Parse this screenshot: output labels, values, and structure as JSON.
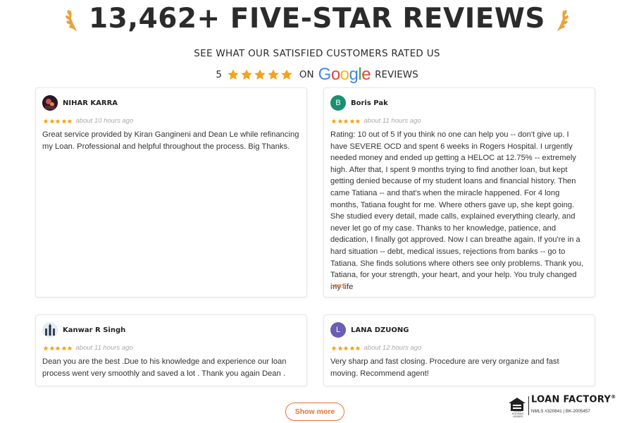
{
  "header": {
    "title": "13,462+ FIVE-STAR REVIEWS",
    "subtitle": "SEE WHAT OUR SATISFIED CUSTOMERS RATED US",
    "rating_value": "5",
    "rating_stars": 5,
    "on_label": "ON",
    "google_logo_text": "Google",
    "reviews_label": "REVIEWS"
  },
  "reviews": [
    {
      "name": "NIHAR KARRA",
      "avatar": "photo",
      "stars": 5,
      "time": "about 10 hours ago",
      "text": "Great service provided by Kiran Gangineni and Dean Le while refinancing my Loan. Professional and helpful throughout the process. Big Thanks."
    },
    {
      "name": "Boris Pak",
      "avatar": "B",
      "stars": 5,
      "time": "about 11 hours ago",
      "text": "Rating: 10 out of 5 If you think no one can help you -- don't give up. I have SEVERE OCD and spent 6 weeks in Rogers Hospital. I urgently needed money and ended up getting a HELOC at 12.75% -- extremely high. After that, I spent 9 months trying to find another loan, but kept getting denied because of my student loans and financial history. Then came Tatiana -- and that's when the miracle happened. For 4 long months, Tatiana fought for me. Where others gave up, she kept going. She studied every detail, made calls, explained everything clearly, and never let go of my case. Thanks to her knowledge, patience, and dedication, I finally got approved. Now I can breathe again. If you're in a hard situation -- debt, medical issues, rejections from banks -- go to Tatiana. She finds solutions where others see only problems. Thank you, Tatiana, for your strength, your heart, and your help. You truly changed my life",
      "less_label": "Less"
    },
    {
      "name": "Kanwar R Singh",
      "avatar": "photo",
      "stars": 5,
      "time": "about 11 hours ago",
      "text": "Dean you are the best .Due to his knowledge and experience our loan process went very smoothly and saved a lot . Thank you again Dean ."
    },
    {
      "name": "LANA DZUONG",
      "avatar": "L",
      "stars": 5,
      "time": "about 12 hours ago",
      "text": "Very sharp and fast closing. Procedure are very organize and fast moving. Recommend agent!"
    }
  ],
  "show_more_label": "Show more",
  "brand": {
    "name": "LOAN FACTORY",
    "trademark": "®",
    "nmls": "NMLS #320841 | BK-2005457",
    "ehl_text": "EQUAL HOUSING LENDER"
  },
  "colors": {
    "star": "#f7a21b",
    "accent": "#e8732b",
    "title": "#2b2b2b",
    "avatar_b": "#1a8f72",
    "avatar_l": "#6a5db3"
  }
}
